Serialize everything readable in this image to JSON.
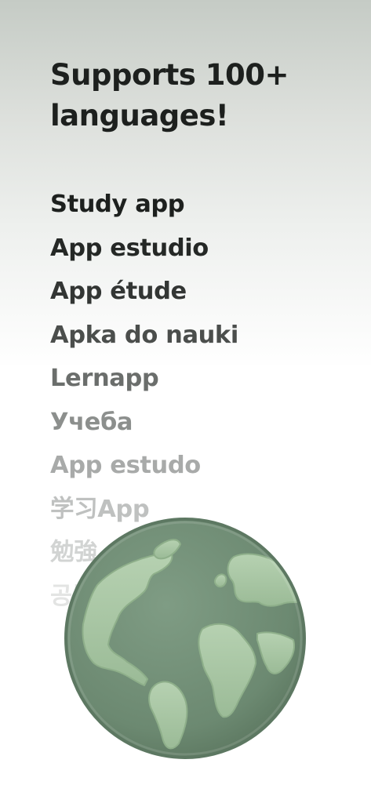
{
  "headline": "Supports 100+ languages!",
  "languages": [
    {
      "label": "Study app",
      "color": "#1d201e"
    },
    {
      "label": "App estudio",
      "color": "#252826"
    },
    {
      "label": "App étude",
      "color": "#333634"
    },
    {
      "label": "Apka do nauki",
      "color": "#4b4e4c"
    },
    {
      "label": "Lernapp",
      "color": "#6b6e6c"
    },
    {
      "label": "Учеба",
      "color": "#8c8f8d"
    },
    {
      "label": "App estudo",
      "color": "#a8aaa9"
    },
    {
      "label": "学习App",
      "color": "#bfc1c0"
    },
    {
      "label": "勉強",
      "color": "#d2d4d3"
    },
    {
      "label": "공부",
      "color": "#e3e4e3"
    }
  ],
  "icon": "globe-icon",
  "colors": {
    "globe_ocean": "#6f8c74",
    "globe_land": "#a6c4a2"
  }
}
